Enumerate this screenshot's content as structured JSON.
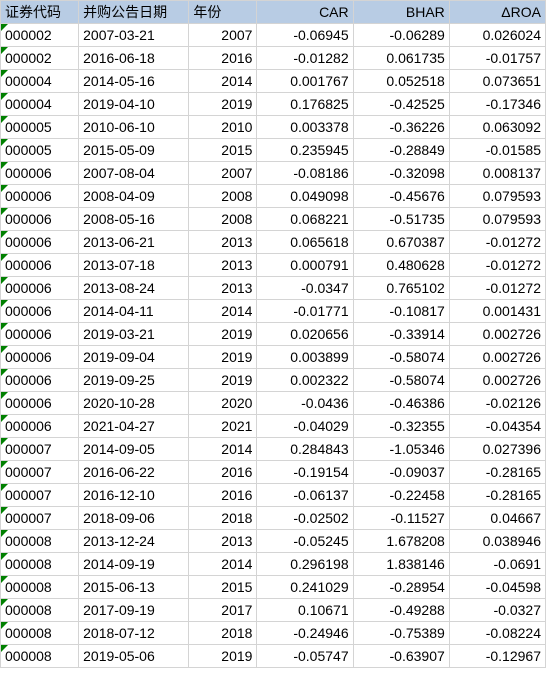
{
  "headers": {
    "code": "证券代码",
    "date": "并购公告日期",
    "year": "年份",
    "car": "CAR",
    "bhar": "BHAR",
    "droa": "ΔROA"
  },
  "rows": [
    {
      "code": "000002",
      "date": "2007-03-21",
      "year": "2007",
      "car": "-0.06945",
      "bhar": "-0.06289",
      "droa": "0.026024"
    },
    {
      "code": "000002",
      "date": "2016-06-18",
      "year": "2016",
      "car": "-0.01282",
      "bhar": "0.061735",
      "droa": "-0.01757"
    },
    {
      "code": "000004",
      "date": "2014-05-16",
      "year": "2014",
      "car": "0.001767",
      "bhar": "0.052518",
      "droa": "0.073651"
    },
    {
      "code": "000004",
      "date": "2019-04-10",
      "year": "2019",
      "car": "0.176825",
      "bhar": "-0.42525",
      "droa": "-0.17346"
    },
    {
      "code": "000005",
      "date": "2010-06-10",
      "year": "2010",
      "car": "0.003378",
      "bhar": "-0.36226",
      "droa": "0.063092"
    },
    {
      "code": "000005",
      "date": "2015-05-09",
      "year": "2015",
      "car": "0.235945",
      "bhar": "-0.28849",
      "droa": "-0.01585"
    },
    {
      "code": "000006",
      "date": "2007-08-04",
      "year": "2007",
      "car": "-0.08186",
      "bhar": "-0.32098",
      "droa": "0.008137"
    },
    {
      "code": "000006",
      "date": "2008-04-09",
      "year": "2008",
      "car": "0.049098",
      "bhar": "-0.45676",
      "droa": "0.079593"
    },
    {
      "code": "000006",
      "date": "2008-05-16",
      "year": "2008",
      "car": "0.068221",
      "bhar": "-0.51735",
      "droa": "0.079593"
    },
    {
      "code": "000006",
      "date": "2013-06-21",
      "year": "2013",
      "car": "0.065618",
      "bhar": "0.670387",
      "droa": "-0.01272"
    },
    {
      "code": "000006",
      "date": "2013-07-18",
      "year": "2013",
      "car": "0.000791",
      "bhar": "0.480628",
      "droa": "-0.01272"
    },
    {
      "code": "000006",
      "date": "2013-08-24",
      "year": "2013",
      "car": "-0.0347",
      "bhar": "0.765102",
      "droa": "-0.01272"
    },
    {
      "code": "000006",
      "date": "2014-04-11",
      "year": "2014",
      "car": "-0.01771",
      "bhar": "-0.10817",
      "droa": "0.001431"
    },
    {
      "code": "000006",
      "date": "2019-03-21",
      "year": "2019",
      "car": "0.020656",
      "bhar": "-0.33914",
      "droa": "0.002726"
    },
    {
      "code": "000006",
      "date": "2019-09-04",
      "year": "2019",
      "car": "0.003899",
      "bhar": "-0.58074",
      "droa": "0.002726"
    },
    {
      "code": "000006",
      "date": "2019-09-25",
      "year": "2019",
      "car": "0.002322",
      "bhar": "-0.58074",
      "droa": "0.002726"
    },
    {
      "code": "000006",
      "date": "2020-10-28",
      "year": "2020",
      "car": "-0.0436",
      "bhar": "-0.46386",
      "droa": "-0.02126"
    },
    {
      "code": "000006",
      "date": "2021-04-27",
      "year": "2021",
      "car": "-0.04029",
      "bhar": "-0.32355",
      "droa": "-0.04354"
    },
    {
      "code": "000007",
      "date": "2014-09-05",
      "year": "2014",
      "car": "0.284843",
      "bhar": "-1.05346",
      "droa": "0.027396"
    },
    {
      "code": "000007",
      "date": "2016-06-22",
      "year": "2016",
      "car": "-0.19154",
      "bhar": "-0.09037",
      "droa": "-0.28165"
    },
    {
      "code": "000007",
      "date": "2016-12-10",
      "year": "2016",
      "car": "-0.06137",
      "bhar": "-0.22458",
      "droa": "-0.28165"
    },
    {
      "code": "000007",
      "date": "2018-09-06",
      "year": "2018",
      "car": "-0.02502",
      "bhar": "-0.11527",
      "droa": "0.04667"
    },
    {
      "code": "000008",
      "date": "2013-12-24",
      "year": "2013",
      "car": "-0.05245",
      "bhar": "1.678208",
      "droa": "0.038946"
    },
    {
      "code": "000008",
      "date": "2014-09-19",
      "year": "2014",
      "car": "0.296198",
      "bhar": "1.838146",
      "droa": "-0.0691"
    },
    {
      "code": "000008",
      "date": "2015-06-13",
      "year": "2015",
      "car": "0.241029",
      "bhar": "-0.28954",
      "droa": "-0.04598"
    },
    {
      "code": "000008",
      "date": "2017-09-19",
      "year": "2017",
      "car": "0.10671",
      "bhar": "-0.49288",
      "droa": "-0.0327"
    },
    {
      "code": "000008",
      "date": "2018-07-12",
      "year": "2018",
      "car": "-0.24946",
      "bhar": "-0.75389",
      "droa": "-0.08224"
    },
    {
      "code": "000008",
      "date": "2019-05-06",
      "year": "2019",
      "car": "-0.05747",
      "bhar": "-0.63907",
      "droa": "-0.12967"
    }
  ]
}
